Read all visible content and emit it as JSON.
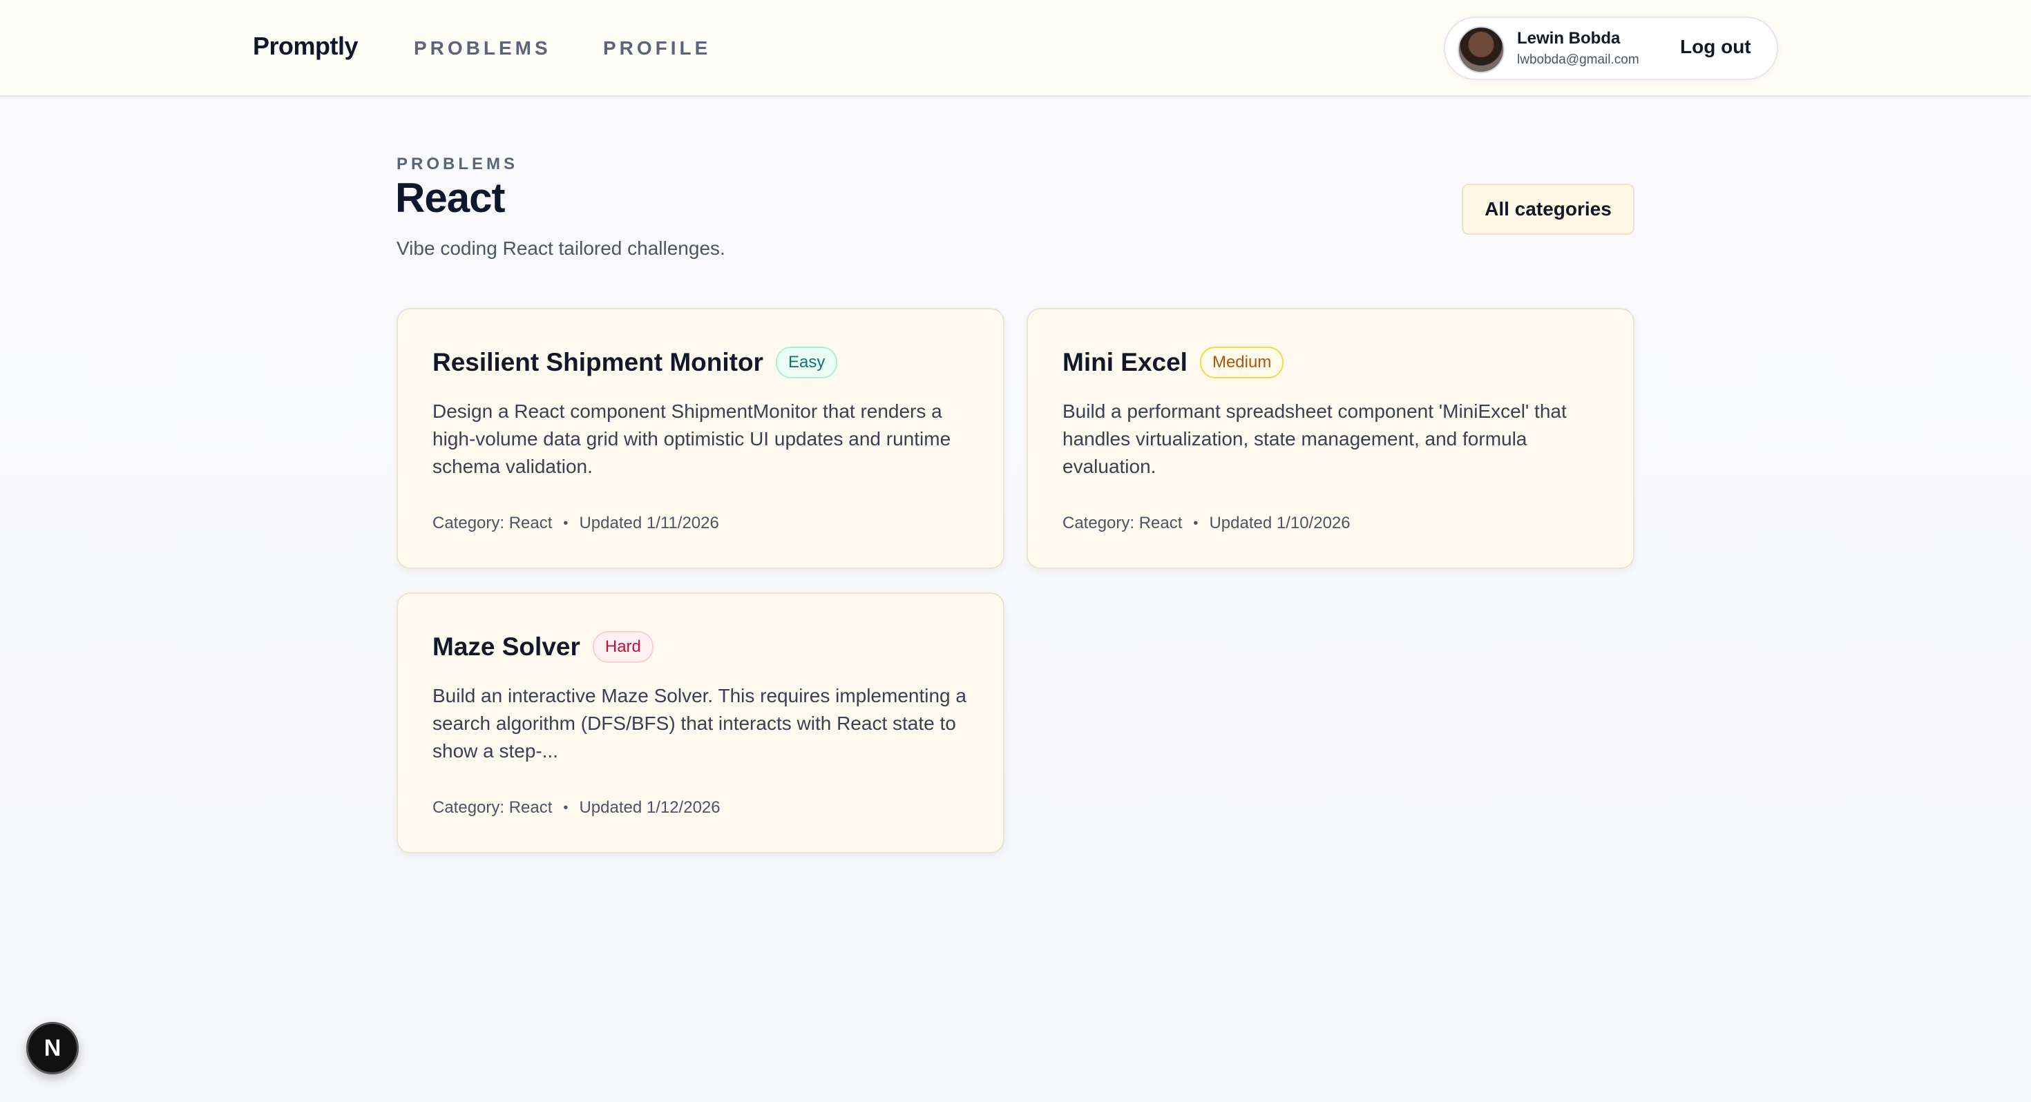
{
  "header": {
    "brand": "Promptly",
    "nav": [
      {
        "label": "PROBLEMS"
      },
      {
        "label": "PROFILE"
      }
    ],
    "user": {
      "name": "Lewin Bobda",
      "email": "lwbobda@gmail.com",
      "logout_label": "Log out"
    }
  },
  "main": {
    "eyebrow": "PROBLEMS",
    "title": "React",
    "subtitle": "Vibe coding React tailored challenges.",
    "category_filter": "All categories",
    "cards": [
      {
        "title": "Resilient Shipment Monitor",
        "difficulty": "Easy",
        "description": "Design a React component ShipmentMonitor that renders a high-volume data grid with optimistic UI updates and runtime schema validation.",
        "category": "Category: React",
        "updated": "Updated 1/11/2026"
      },
      {
        "title": "Mini Excel",
        "difficulty": "Medium",
        "description": "Build a performant spreadsheet component 'MiniExcel' that handles virtualization, state management, and formula evaluation.",
        "category": "Category: React",
        "updated": "Updated 1/10/2026"
      },
      {
        "title": "Maze Solver",
        "difficulty": "Hard",
        "description": "Build an interactive Maze Solver. This requires implementing a search algorithm (DFS/BFS) that interacts with React state to show a step-...",
        "category": "Category: React",
        "updated": "Updated 1/12/2026"
      }
    ]
  },
  "dev_badge": "N",
  "colors": {
    "easy": "#0f766e",
    "medium": "#b45309",
    "hard": "#be123c",
    "card_bg": "#fffaef"
  }
}
